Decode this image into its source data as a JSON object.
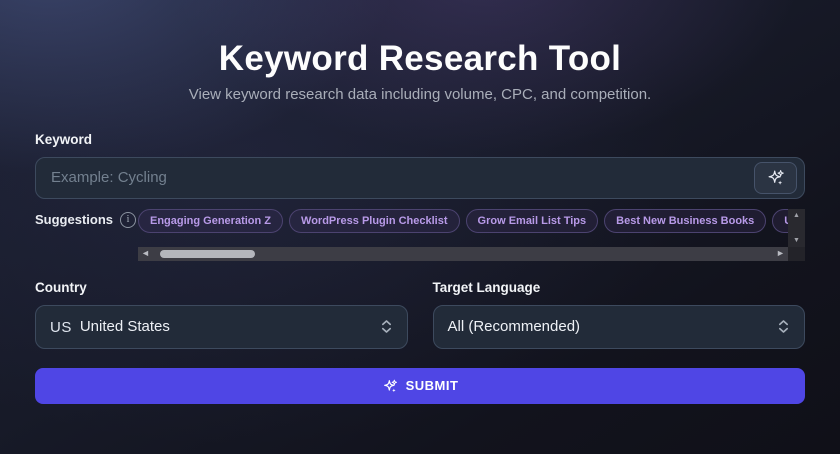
{
  "page": {
    "title": "Keyword Research Tool",
    "subtitle": "View keyword research data including volume, CPC, and competition."
  },
  "keyword": {
    "label": "Keyword",
    "placeholder": "Example: Cycling"
  },
  "suggestions": {
    "label": "Suggestions",
    "chips": [
      "Engaging Generation Z",
      "WordPress Plugin Checklist",
      "Grow Email List Tips",
      "Best New Business Books",
      "Upcom"
    ]
  },
  "country": {
    "label": "Country",
    "flag_text": "US",
    "value": "United States"
  },
  "language": {
    "label": "Target Language",
    "value": "All (Recommended)"
  },
  "submit": {
    "label": "SUBMIT"
  },
  "icons": {
    "info": "i",
    "up": "▲",
    "down": "▼",
    "left": "◄",
    "right": "►"
  },
  "colors": {
    "accent": "#4f46e5",
    "chip_text": "#b89ae8",
    "chip_border": "#4c4370",
    "field_bg": "#222b39",
    "field_border": "#3d4a5e",
    "scroll_thumb": "#b4b6bc"
  }
}
